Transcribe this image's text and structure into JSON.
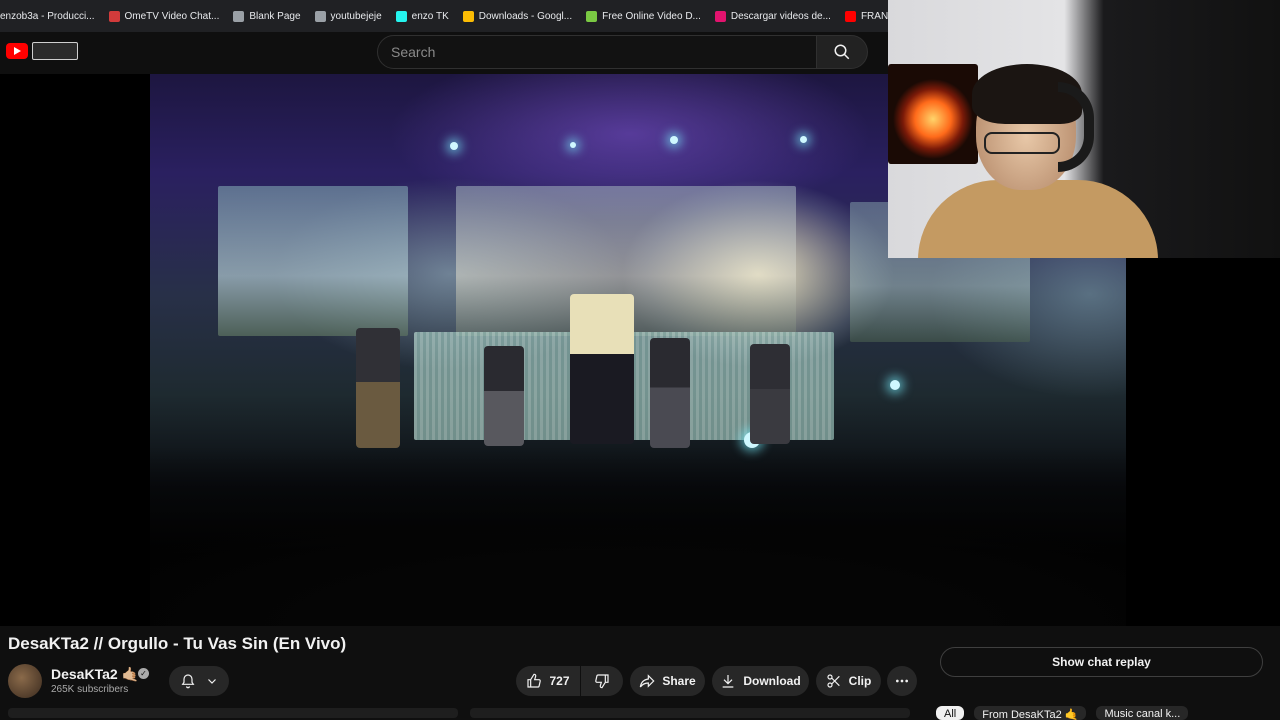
{
  "bookmarks": [
    {
      "label": "enzob3a - Producci...",
      "color": "#cc3a3a"
    },
    {
      "label": "OmeTV Video Chat...",
      "color": "#d23b3b"
    },
    {
      "label": "Blank Page",
      "color": "#9aa0a6"
    },
    {
      "label": "youtubejeje",
      "color": "#9aa0a6"
    },
    {
      "label": "enzo TK",
      "color": "#25f4ee"
    },
    {
      "label": "Downloads - Googl...",
      "color": "#fbbc04"
    },
    {
      "label": "Free Online Video D...",
      "color": "#7ac943"
    },
    {
      "label": "Descargar videos de...",
      "color": "#e2136e"
    },
    {
      "label": "FRANCIS is a YOUT...",
      "color": "#ff0000"
    }
  ],
  "search": {
    "placeholder": "Search"
  },
  "video": {
    "title": "DesaKTa2 // Orgullo - Tu Vas Sin (En Vivo)"
  },
  "channel": {
    "name": "DesaKTa2 🤙🏼",
    "subscribers": "265K subscribers"
  },
  "actions": {
    "likes": "727",
    "share": "Share",
    "download": "Download",
    "clip": "Clip"
  },
  "chat": {
    "show_replay": "Show chat replay"
  },
  "chips": [
    "All",
    "From DesaKTa2 🤙",
    "Music canal k..."
  ],
  "colors": {
    "accent": "#ff0000",
    "background": "#0f0f0f",
    "pill": "#272727"
  }
}
